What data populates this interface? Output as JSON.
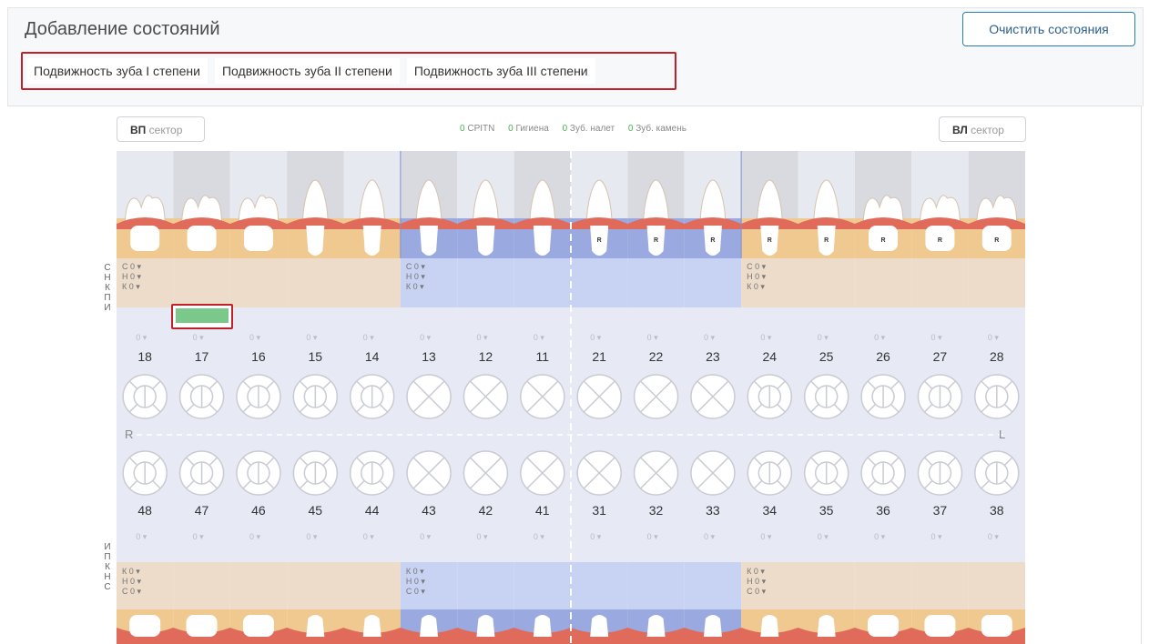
{
  "header": {
    "title": "Добавление состояний",
    "clear_button": "Очистить состояния"
  },
  "chips": [
    "Подвижность зуба I степени",
    "Подвижность зуба II степени",
    "Подвижность зуба III степени"
  ],
  "sectors": {
    "left_bold": "ВП",
    "right_bold": "ВЛ",
    "suffix": "сектор"
  },
  "summary": [
    {
      "count": "0",
      "label": "CPITN"
    },
    {
      "count": "0",
      "label": "Гигиена"
    },
    {
      "count": "0",
      "label": "Зуб. налет"
    },
    {
      "count": "0",
      "label": "Зуб. камень"
    }
  ],
  "upper_teeth": [
    "18",
    "17",
    "16",
    "15",
    "14",
    "13",
    "12",
    "11",
    "21",
    "22",
    "23",
    "24",
    "25",
    "26",
    "27",
    "28"
  ],
  "lower_teeth": [
    "48",
    "47",
    "46",
    "45",
    "44",
    "43",
    "42",
    "41",
    "31",
    "32",
    "33",
    "34",
    "35",
    "36",
    "37",
    "38"
  ],
  "upper_r_marks": [
    "21",
    "22",
    "23",
    "24",
    "25",
    "26",
    "27",
    "28"
  ],
  "upper_side_letters": [
    "С",
    "Н",
    "К",
    "П",
    "И"
  ],
  "lower_side_letters": [
    "И",
    "П",
    "К",
    "Н",
    "С"
  ],
  "ctl_upper": [
    "С 0",
    "Н 0",
    "К 0"
  ],
  "ctl_lower": [
    "К 0",
    "Н 0",
    "С 0"
  ],
  "mobility_value": "0",
  "side_left": "R",
  "side_right": "L",
  "r_mark": "R",
  "colors": {
    "gum": "#e06b5b",
    "root_bg": "#f0c990",
    "blue_zone": "#9aaae0",
    "bone_beige": "#ecdcc9",
    "bone_blue": "#c8d2f2",
    "chart_bg": "#e7e9f5",
    "selected_green": "#7ac98a",
    "highlight_red": "#c0202a"
  }
}
